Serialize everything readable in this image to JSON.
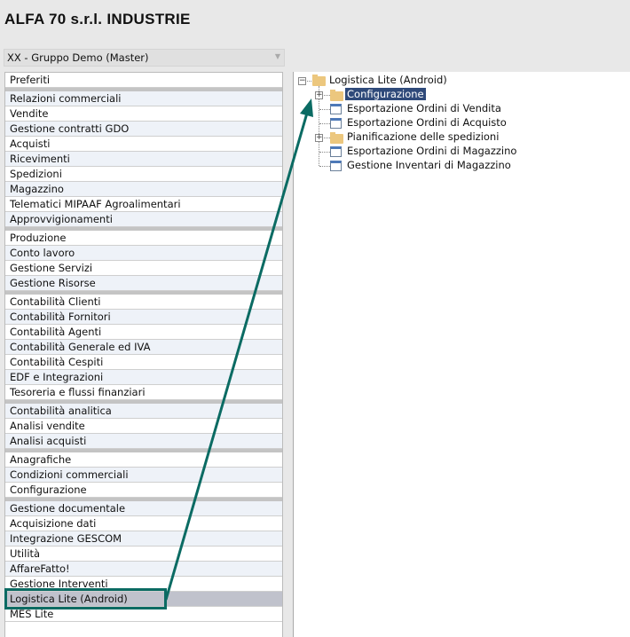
{
  "header": {
    "title": "ALFA 70 s.r.l. INDUSTRIE"
  },
  "company_select": {
    "value": "XX - Gruppo Demo (Master)"
  },
  "menu": {
    "groups": [
      [
        "Preferiti"
      ],
      [
        "Relazioni commerciali",
        "Vendite",
        "Gestione contratti GDO",
        "Acquisti",
        "Ricevimenti",
        "Spedizioni",
        "Magazzino",
        "Telematici MIPAAF Agroalimentari",
        "Approvvigionamenti"
      ],
      [
        "Produzione",
        "Conto lavoro",
        "Gestione Servizi",
        "Gestione Risorse"
      ],
      [
        "Contabilità Clienti",
        "Contabilità Fornitori",
        "Contabilità Agenti",
        "Contabilità Generale ed IVA",
        "Contabilità Cespiti",
        "EDF e Integrazioni",
        "Tesoreria e flussi finanziari"
      ],
      [
        "Contabilità analitica",
        "Analisi vendite",
        "Analisi acquisti"
      ],
      [
        "Anagrafiche",
        "Condizioni commerciali",
        "Configurazione"
      ],
      [
        "Gestione documentale",
        "Acquisizione dati",
        "Integrazione GESCOM",
        "Utilità",
        "AffareFatto!",
        "Gestione Interventi",
        "Logistica Lite (Android)",
        "MES Lite"
      ]
    ],
    "selected": "Logistica Lite (Android)"
  },
  "tree": {
    "root": "Logistica Lite (Android)",
    "children": [
      {
        "label": "Configurazione",
        "type": "folder",
        "expandable": true,
        "selected": true
      },
      {
        "label": "Esportazione Ordini di Vendita",
        "type": "doc"
      },
      {
        "label": "Esportazione Ordini di Acquisto",
        "type": "doc"
      },
      {
        "label": "Pianificazione delle spedizioni",
        "type": "folder",
        "expandable": true
      },
      {
        "label": "Esportazione Ordini di Magazzino",
        "type": "doc"
      },
      {
        "label": "Gestione Inventari di Magazzino",
        "type": "doc"
      }
    ]
  },
  "annotation_color": "#0b6b63"
}
